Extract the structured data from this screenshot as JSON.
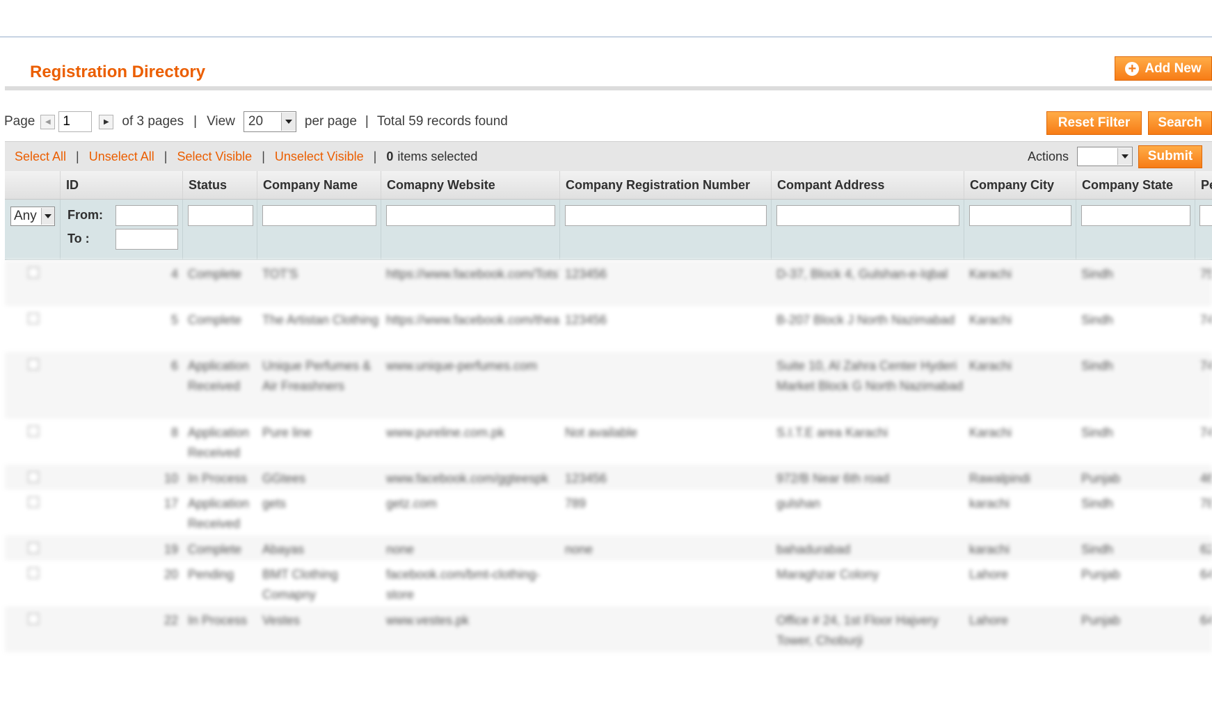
{
  "header": {
    "title": "Registration Directory",
    "add_new_label": "Add New"
  },
  "pager": {
    "page_label": "Page",
    "page_value": "1",
    "of_pages": "of 3 pages",
    "sep": "|",
    "view_label": "View",
    "view_value": "20",
    "per_page": "per page",
    "total": "Total 59 records found"
  },
  "filter_buttons": {
    "reset": "Reset Filter",
    "search": "Search"
  },
  "massaction": {
    "select_all": "Select All",
    "unselect_all": "Unselect All",
    "select_visible": "Select Visible",
    "unselect_visible": "Unselect Visible",
    "sep": "|",
    "count": "0",
    "count_suffix": "items selected",
    "actions_label": "Actions",
    "submit": "Submit"
  },
  "columns": {
    "id": "ID",
    "status": "Status",
    "company_name": "Company Name",
    "website": "Comapny Website",
    "reg_number": "Company Registration Number",
    "address": "Compant Address",
    "city": "Company City",
    "state": "Company State",
    "next": "Pe"
  },
  "filters": {
    "any": "Any",
    "from": "From:",
    "to": "To :"
  },
  "rows": [
    {
      "id": "4",
      "status": "Complete",
      "name": "TOT'S",
      "website": "https://www.facebook.com/TotsTheBrand",
      "reg": "123456",
      "address": "D-37, Block 4, Gulshan-e-Iqbal",
      "city": "Karachi",
      "state": "Sindh",
      "next": "75"
    },
    {
      "id": "5",
      "status": "Complete",
      "name": "The Artistan Clothing",
      "website": "https://www.facebook.com/theartistanclothing",
      "reg": "123456",
      "address": "B-207 Block J North Nazimabad",
      "city": "Karachi",
      "state": "Sindh",
      "next": "74"
    },
    {
      "id": "6",
      "status": "Application Received",
      "name": "Unique Perfumes & Air Freashners",
      "website": "www.unique-perfumes.com",
      "reg": "",
      "address": "Suite 10, Al Zahra Center Hyderi Market Block G North Nazimabad",
      "city": "Karachi",
      "state": "Sindh",
      "next": "74"
    },
    {
      "id": "8",
      "status": "Application Received",
      "name": "Pure line",
      "website": "www.pureline.com.pk",
      "reg": "Not available",
      "address": "S.I.T.E area Karachi",
      "city": "Karachi",
      "state": "Sindh",
      "next": "74"
    },
    {
      "id": "10",
      "status": "In Process",
      "name": "GGtees",
      "website": "www.facebook.com/ggteespk",
      "reg": "123456",
      "address": "972/B Near 6th road",
      "city": "Rawalpindi",
      "state": "Punjab",
      "next": "46"
    },
    {
      "id": "17",
      "status": "Application Received",
      "name": "gets",
      "website": "getz.com",
      "reg": "789",
      "address": "gulshan",
      "city": "karachi",
      "state": "Sindh",
      "next": "78"
    },
    {
      "id": "19",
      "status": "Complete",
      "name": "Abayas",
      "website": "none",
      "reg": "none",
      "address": "bahadurabad",
      "city": "karachi",
      "state": "Sindh",
      "next": "62"
    },
    {
      "id": "20",
      "status": "Pending",
      "name": "BMT Clothing Comapny",
      "website": "facebook.com/bmt-clothing-store",
      "reg": "",
      "address": "Maraghzar Colony",
      "city": "Lahore",
      "state": "Punjab",
      "next": "64"
    },
    {
      "id": "22",
      "status": "In Process",
      "name": "Vestes",
      "website": "www.vestes.pk",
      "reg": "",
      "address": "Office # 24, 1st Floor Hajvery Tower, Choburji",
      "city": "Lahore",
      "state": "Punjab",
      "next": "64"
    }
  ]
}
